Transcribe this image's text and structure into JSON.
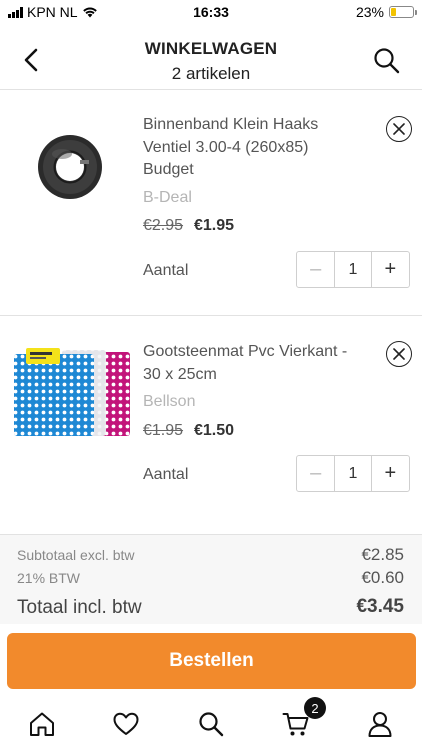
{
  "status_bar": {
    "carrier": "KPN NL",
    "time": "16:33",
    "battery_percent": "23%",
    "battery_level": 0.23,
    "battery_color": "#f2c200"
  },
  "header": {
    "title": "WINKELWAGEN",
    "subtitle": "2 artikelen",
    "back_icon": "chevron-left-icon",
    "search_icon": "search-icon"
  },
  "items": [
    {
      "name": "Binnenband Klein Haaks Ventiel 3.00-4 (260x85) Budget",
      "brand": "B-Deal",
      "old_price": "€2.95",
      "price": "€1.95",
      "qty_label": "Aantal",
      "quantity": "1",
      "minus": "–",
      "plus": "+"
    },
    {
      "name": "Gootsteenmat Pvc Vierkant - 30 x 25cm",
      "brand": "Bellson",
      "old_price": "€1.95",
      "price": "€1.50",
      "qty_label": "Aantal",
      "quantity": "1",
      "minus": "–",
      "plus": "+"
    }
  ],
  "totals": {
    "subtotal_label": "Subtotaal excl. btw",
    "subtotal_value": "€2.85",
    "vat_label": "21% BTW",
    "vat_value": "€0.60",
    "total_label": "Totaal incl. btw",
    "total_value": "€3.45"
  },
  "order_button": "Bestellen",
  "bottom_nav": {
    "items": [
      "home-icon",
      "heart-icon",
      "search-icon",
      "cart-icon",
      "user-icon"
    ],
    "cart_badge": "2"
  },
  "colors": {
    "accent": "#f28a2c"
  }
}
